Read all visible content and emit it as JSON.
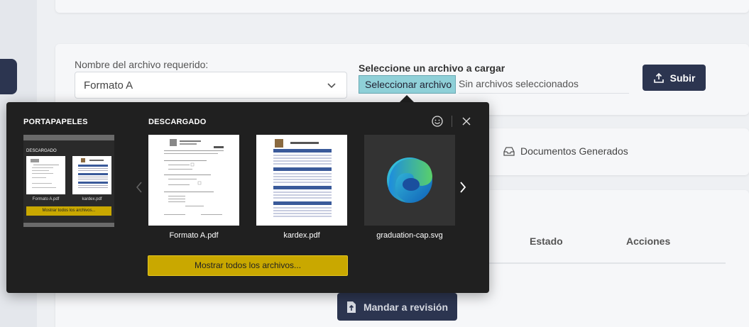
{
  "upload": {
    "required_label": "Nombre del archivo requerido:",
    "required_value": "Formato A",
    "select_label": "Seleccione un archivo a cargar",
    "file_button": "Seleccionar archivo",
    "file_status": "Sin archivos seleccionados",
    "submit_label": "Subir"
  },
  "tabs": {
    "documents_generated": "Documentos Generados"
  },
  "table": {
    "headers": [
      "Estado",
      "Acciones"
    ]
  },
  "actions": {
    "send_review": "Mandar a revisión"
  },
  "downloads_popup": {
    "clipboard_title": "PORTAPAPELES",
    "clipboard_preview": {
      "section": "DESCARGADO",
      "files": [
        "Formato A.pdf",
        "kardex.pdf"
      ],
      "button": "Mostrar todos los archivos..."
    },
    "downloaded_title": "DESCARGADO",
    "files": [
      {
        "name": "Formato A.pdf",
        "kind": "pdf-document"
      },
      {
        "name": "kardex.pdf",
        "kind": "pdf-table"
      },
      {
        "name": "graduation-cap.svg",
        "kind": "edge-icon"
      }
    ],
    "show_all_button": "Mostrar todos los archivos..."
  },
  "colors": {
    "primary_dark": "#2c3550",
    "popup_bg": "#202020",
    "accent_yellow": "#c9a800",
    "file_button_bg": "#8fd0d8"
  }
}
